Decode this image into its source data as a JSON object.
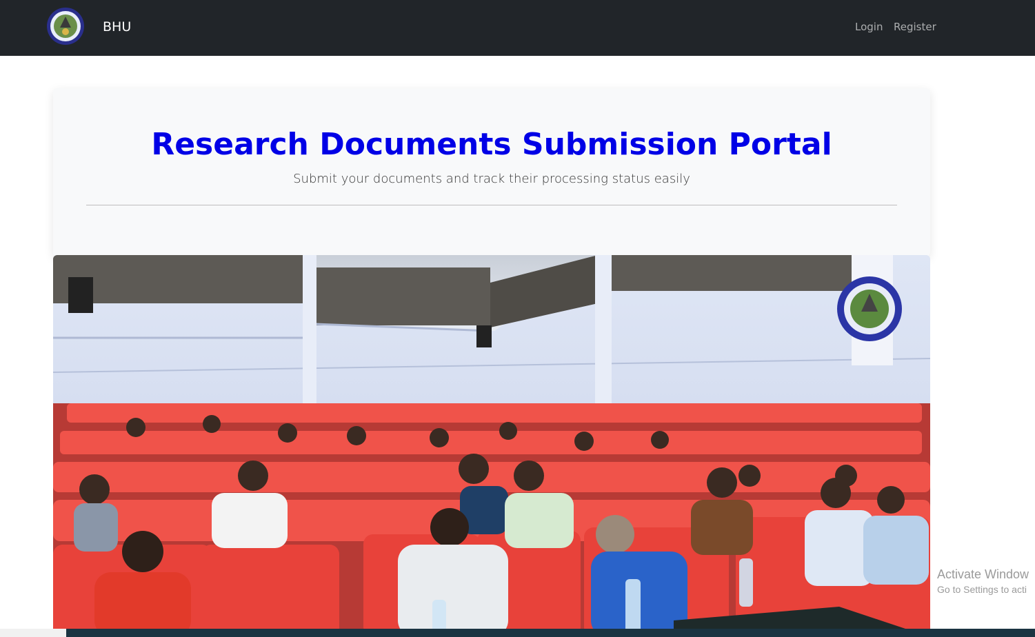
{
  "navbar": {
    "brand": "BHU",
    "links": [
      {
        "label": "Login"
      },
      {
        "label": "Register"
      }
    ],
    "logo_icon": "university-seal-icon"
  },
  "hero": {
    "title": "Research Documents Submission Portal",
    "subtitle": "Submit your documents and track their processing status easily",
    "image": "lecture-hall-students-photo"
  },
  "watermark": {
    "line1": "Activate Window",
    "line2": "Go to Settings to acti"
  },
  "colors": {
    "navbar_bg": "#212529",
    "title": "#0000e6",
    "card_bg": "#f8f9fa"
  }
}
